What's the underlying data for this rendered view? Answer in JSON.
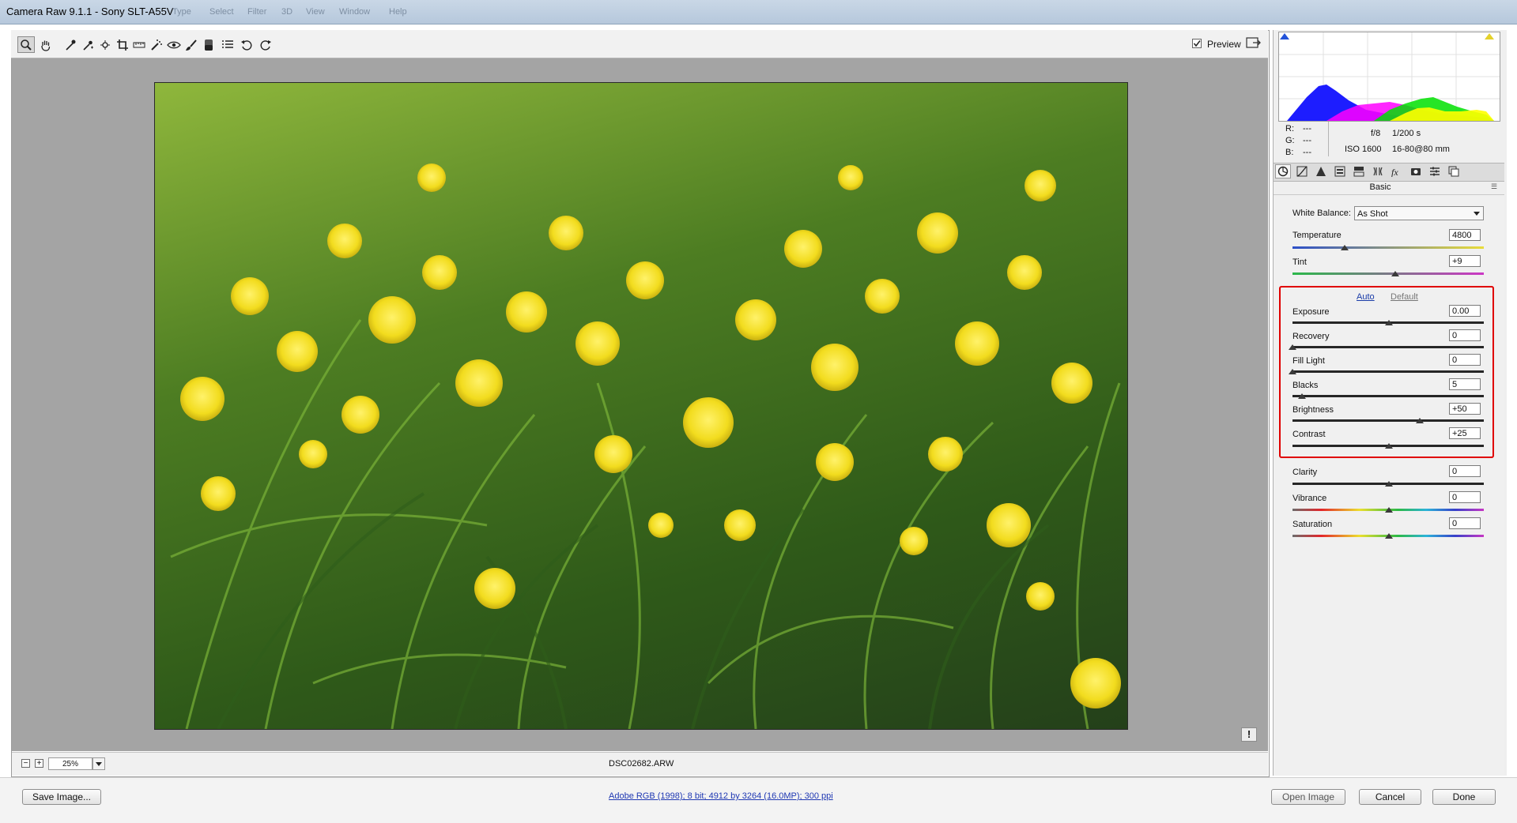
{
  "window": {
    "title": "Camera Raw 9.1.1  -  Sony SLT-A55V",
    "ghost_menu": [
      "Type",
      "Select",
      "Filter",
      "3D",
      "View",
      "Window",
      "Help"
    ]
  },
  "toolbar": {
    "tools": [
      "zoom-tool",
      "hand-tool",
      "white-balance-tool",
      "color-sampler-tool",
      "targeted-adjustment-tool",
      "crop-tool",
      "straighten-tool",
      "spot-removal-tool",
      "red-eye-removal-tool",
      "adjustment-brush-tool",
      "graduated-filter-tool",
      "radial-filter-tool",
      "preferences",
      "rotate-ccw",
      "rotate-cw"
    ],
    "preview_label": "Preview",
    "preview_checked": true
  },
  "status": {
    "zoom_value": "25%",
    "filename": "DSC02682.ARW",
    "zoom_out_label": "−",
    "zoom_in_label": "+"
  },
  "histogram_info": {
    "r_label": "R:",
    "r_value": "---",
    "g_label": "G:",
    "g_value": "---",
    "b_label": "B:",
    "b_value": "---",
    "aperture": "f/8",
    "shutter": "1/200 s",
    "iso": "ISO 1600",
    "lens": "16-80@80 mm"
  },
  "panel_tabs": [
    "basic",
    "tone-curve",
    "detail",
    "hsl-grayscale",
    "split-toning",
    "lens-corrections",
    "effects",
    "camera-calibration",
    "presets",
    "snapshots"
  ],
  "panel": {
    "title": "Basic",
    "white_balance_label": "White Balance:",
    "white_balance_value": "As Shot",
    "auto_label": "Auto",
    "default_label": "Default",
    "sliders": {
      "temperature": {
        "label": "Temperature",
        "value": "4800"
      },
      "tint": {
        "label": "Tint",
        "value": "+9"
      },
      "exposure": {
        "label": "Exposure",
        "value": "0.00"
      },
      "recovery": {
        "label": "Recovery",
        "value": "0"
      },
      "fill_light": {
        "label": "Fill Light",
        "value": "0"
      },
      "blacks": {
        "label": "Blacks",
        "value": "5"
      },
      "brightness": {
        "label": "Brightness",
        "value": "+50"
      },
      "contrast": {
        "label": "Contrast",
        "value": "+25"
      },
      "clarity": {
        "label": "Clarity",
        "value": "0"
      },
      "vibrance": {
        "label": "Vibrance",
        "value": "0"
      },
      "saturation": {
        "label": "Saturation",
        "value": "0"
      }
    }
  },
  "bottom": {
    "save_label": "Save Image...",
    "workflow_label": "Adobe RGB (1998); 8 bit; 4912 by 3264 (16.0MP); 300 ppi",
    "open_label": "Open Image",
    "cancel_label": "Cancel",
    "done_label": "Done"
  },
  "colors": {
    "highlight_border": "#e00000",
    "link_blue": "#1f38b3",
    "canvas_gray": "#a4a4a4"
  }
}
